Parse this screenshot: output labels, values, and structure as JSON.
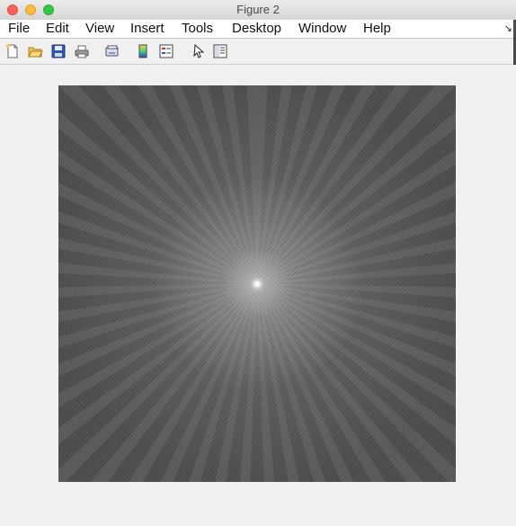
{
  "window": {
    "title": "Figure 2"
  },
  "menubar": {
    "items": [
      {
        "id": "file",
        "label": "File"
      },
      {
        "id": "edit",
        "label": "Edit"
      },
      {
        "id": "view",
        "label": "View"
      },
      {
        "id": "insert",
        "label": "Insert"
      },
      {
        "id": "tools",
        "label": "Tools"
      },
      {
        "id": "desktop",
        "label": "Desktop"
      },
      {
        "id": "window",
        "label": "Window"
      },
      {
        "id": "help",
        "label": "Help"
      }
    ],
    "overflow_glyph": "↘"
  },
  "toolbar": {
    "buttons": [
      {
        "name": "new-figure-icon"
      },
      {
        "name": "open-file-icon"
      },
      {
        "name": "save-icon"
      },
      {
        "name": "print-icon"
      },
      {
        "name": "link-plot-icon"
      },
      {
        "name": "insert-colorbar-icon"
      },
      {
        "name": "insert-legend-icon"
      },
      {
        "name": "edit-plot-pointer-icon"
      },
      {
        "name": "property-inspector-icon"
      }
    ]
  },
  "figure": {
    "content": "fourier-spectrum-image",
    "colors": {
      "background": "#525252",
      "center": "#ffffff"
    }
  }
}
